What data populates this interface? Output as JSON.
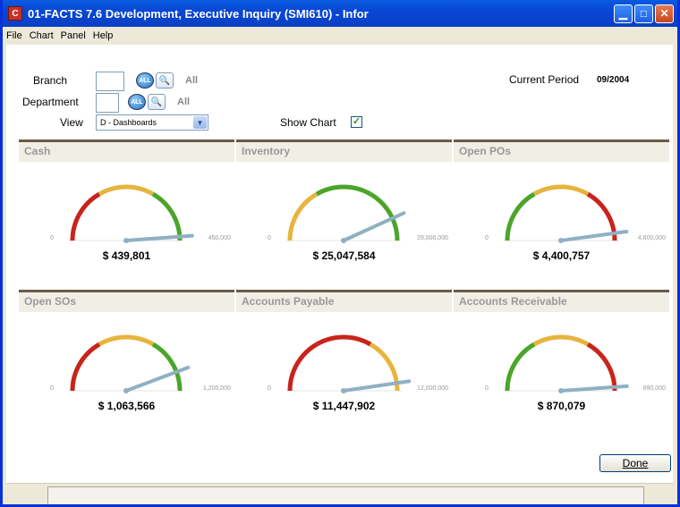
{
  "window": {
    "title": "01-FACTS 7.6 Development, Executive Inquiry (SMI610) - Infor",
    "app_icon": "infor-logo-icon",
    "buttons": {
      "minimize": "minimize-icon",
      "maximize": "maximize-icon",
      "close": "close-icon"
    }
  },
  "menu": {
    "items": [
      "File",
      "Chart",
      "Panel",
      "Help"
    ]
  },
  "filters": {
    "branch": {
      "label": "Branch",
      "value": "",
      "all_button": "ALL",
      "all_text": "All"
    },
    "department": {
      "label": "Department",
      "value": "",
      "all_button": "ALL",
      "all_text": "All"
    },
    "view": {
      "label": "View",
      "selected": "D - Dashboards"
    },
    "show_chart": {
      "label": "Show Chart",
      "checked": true
    },
    "current_period": {
      "label": "Current Period",
      "value": "09/2004"
    }
  },
  "colors": {
    "red": "#c8241c",
    "yellow": "#e7b43e",
    "green": "#4aa52a",
    "needle": "#8fb0c2",
    "panel_border": "#6b5b47"
  },
  "gauges": [
    {
      "title": "Cash",
      "min": "0",
      "max": "450,000",
      "value_text": "$ 439,801",
      "fraction": 0.977,
      "zones": [
        "red",
        "yellow",
        "green"
      ]
    },
    {
      "title": "Inventory",
      "min": "0",
      "max": "29,000,000",
      "value_text": "$ 25,047,584",
      "fraction": 0.864,
      "zones": [
        "yellow",
        "green",
        "green"
      ]
    },
    {
      "title": "Open POs",
      "min": "0",
      "max": "4,600,000",
      "value_text": "$ 4,400,757",
      "fraction": 0.957,
      "zones": [
        "green",
        "yellow",
        "red"
      ]
    },
    {
      "title": "Open SOs",
      "min": "0",
      "max": "1,200,000",
      "value_text": "$ 1,063,566",
      "fraction": 0.886,
      "zones": [
        "red",
        "yellow",
        "green"
      ]
    },
    {
      "title": "Accounts Payable",
      "min": "0",
      "max": "12,000,000",
      "value_text": "$ 11,447,902",
      "fraction": 0.954,
      "zones": [
        "red",
        "red",
        "yellow"
      ]
    },
    {
      "title": "Accounts Receivable",
      "min": "0",
      "max": "890,000",
      "value_text": "$ 870,079",
      "fraction": 0.978,
      "zones": [
        "green",
        "yellow",
        "red"
      ]
    }
  ],
  "actions": {
    "done": "Done"
  }
}
